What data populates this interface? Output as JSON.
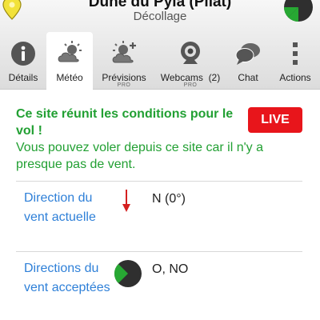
{
  "site": {
    "title": "Dune du Pyla (Pilat)",
    "subtitle": "Décollage"
  },
  "tabs": [
    {
      "label": "Détails",
      "pro": "",
      "icon": "info-icon"
    },
    {
      "label": "Météo",
      "pro": "",
      "icon": "weather-cloud-sun-icon",
      "active": true
    },
    {
      "label": "Prévisions",
      "pro": "PRO",
      "icon": "forecast-sun-plus-icon"
    },
    {
      "label": "Webcams",
      "count": "(2)",
      "pro": "PRO",
      "icon": "webcam-icon"
    },
    {
      "label": "Chat",
      "pro": "",
      "icon": "chat-bubbles-icon"
    },
    {
      "label": "Actions",
      "pro": "",
      "icon": "more-vertical-icon"
    }
  ],
  "conditions": {
    "title": "Ce site réunit les conditions pour le vol !",
    "text": "Vous pouvez voler depuis ce site car il n'y a presque pas de vent.",
    "live_badge": "LIVE"
  },
  "wind_current": {
    "label": "Direction du vent actuelle",
    "value": "N (0°)",
    "icon": "wind-arrow-down-icon"
  },
  "wind_accepted": {
    "label": "Directions du vent acceptées",
    "value": "O, NO",
    "icon": "wind-sector-pie-icon"
  },
  "colors": {
    "green": "#22a033",
    "link_blue": "#2f80d8",
    "live_red": "#e8151b",
    "arrow_red": "#d42020"
  }
}
